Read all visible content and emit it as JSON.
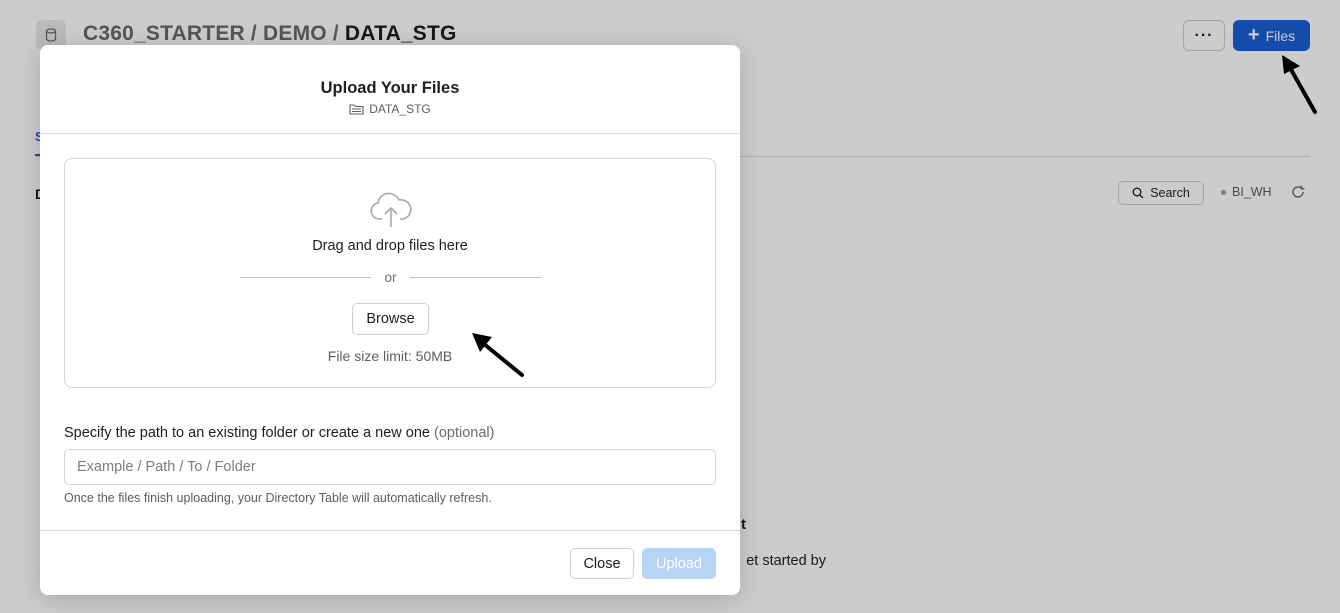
{
  "page": {
    "breadcrumb": {
      "segments": [
        "C360_STARTER",
        "DEMO"
      ],
      "separator": " / ",
      "current": "DATA_STG"
    },
    "more_label": "···",
    "files_button": {
      "icon": "plus-icon",
      "label": "Files"
    },
    "tab_partial": "S",
    "section_partial": "D",
    "search_button": {
      "icon": "search-icon",
      "label": "Search"
    },
    "warehouse": "BI_WH",
    "refresh_icon": "refresh-icon",
    "empty_title_partial": "t",
    "empty_subtitle_partial": "et started by"
  },
  "modal": {
    "title": "Upload Your Files",
    "subtitle": {
      "icon": "folder-icon",
      "text": "DATA_STG"
    },
    "dropzone": {
      "icon": "cloud-upload-icon",
      "drag_text": "Drag and drop files here",
      "or_text": "or",
      "browse_label": "Browse",
      "size_limit": "File size limit: 50MB"
    },
    "path_field": {
      "label": "Specify the path to an existing folder or create a new one",
      "optional": "(optional)",
      "placeholder": "Example / Path / To / Folder",
      "value": "",
      "helper": "Once the files finish uploading, your Directory Table will automatically refresh."
    },
    "footer": {
      "close_label": "Close",
      "upload_label": "Upload",
      "upload_enabled": false
    }
  },
  "colors": {
    "primary": "#1a5fd6",
    "primary_disabled": "#b7d3f6",
    "overlay": "rgba(0,0,0,0.2)"
  }
}
